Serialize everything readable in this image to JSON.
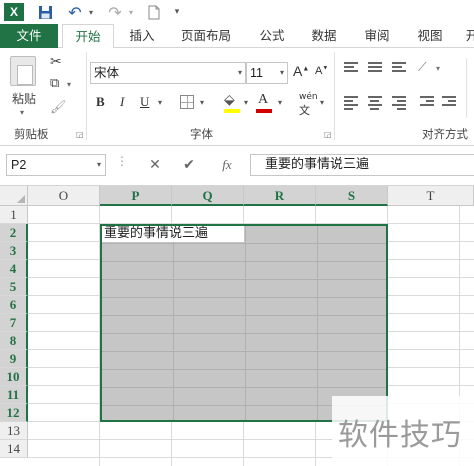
{
  "qat": {
    "excel_logo": "X",
    "icons": [
      "excel-icon",
      "save-icon",
      "undo-icon",
      "redo-icon",
      "new-document-icon",
      "customize-qat-icon"
    ]
  },
  "tabs": {
    "file": "文件",
    "home": "开始",
    "insert": "插入",
    "page_layout": "页面布局",
    "formulas": "公式",
    "data": "数据",
    "review": "审阅",
    "view": "视图",
    "more": "开"
  },
  "ribbon": {
    "clipboard": {
      "paste_label": "粘贴",
      "group_label": "剪贴板"
    },
    "font": {
      "font_name": "宋体",
      "font_size": "11",
      "grow_label": "A",
      "shrink_label": "A",
      "bold_label": "B",
      "italic_label": "I",
      "underline_label": "U",
      "font_color_label": "A",
      "phonetic_label": "wén",
      "fill_color": "#ffff00",
      "font_color": "#d00000",
      "group_label": "字体"
    },
    "alignment": {
      "group_label": "对齐方式"
    }
  },
  "formula_bar": {
    "name_box": "P2",
    "cancel_label": "✕",
    "enter_label": "✔",
    "fx_label": "fx",
    "content": "重要的事情说三遍"
  },
  "sheet": {
    "columns": [
      "O",
      "P",
      "Q",
      "R",
      "S",
      "T"
    ],
    "selected_columns": [
      "P",
      "Q",
      "R",
      "S"
    ],
    "rows": [
      "1",
      "2",
      "3",
      "4",
      "5",
      "6",
      "7",
      "8",
      "9",
      "10",
      "11",
      "12",
      "13",
      "14"
    ],
    "selected_rows": [
      "2",
      "3",
      "4",
      "5",
      "6",
      "7",
      "8",
      "9",
      "10",
      "11",
      "12"
    ],
    "active_cell_text": "重要的事情说三遍",
    "selection_color": "#217346"
  },
  "watermark": "软件技巧"
}
